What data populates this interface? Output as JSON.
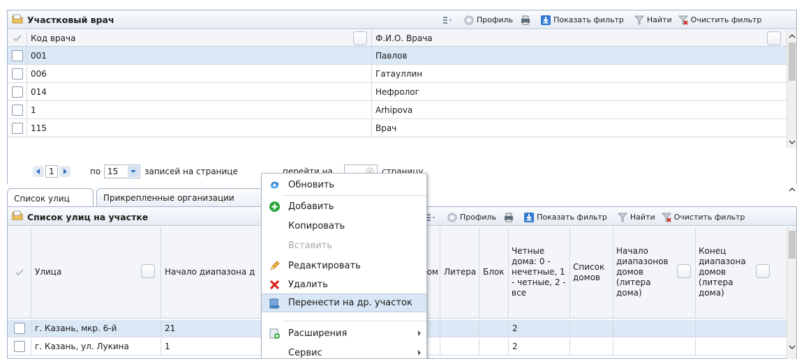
{
  "top_panel": {
    "title": "Участковый врач",
    "toolbar": {
      "profile": "Профиль",
      "show_filter": "Показать фильтр",
      "find": "Найти",
      "clear_filter": "Очистить фильтр"
    },
    "columns": [
      "Код врача",
      "Ф.И.О. Врача"
    ],
    "rows": [
      {
        "code": "001",
        "name": "Павлов",
        "selected": true
      },
      {
        "code": "006",
        "name": "Гатауллин",
        "selected": false
      },
      {
        "code": "014",
        "name": "Нефролог",
        "selected": false
      },
      {
        "code": "1",
        "name": "Arhipova",
        "selected": false
      },
      {
        "code": "115",
        "name": "Врач",
        "selected": false
      }
    ],
    "pager": {
      "current_page": "1",
      "per_page_prefix": "по",
      "per_page": "15",
      "per_page_suffix": "записей на странице",
      "goto_prefix": "перейти на",
      "goto_suffix": "страницу"
    }
  },
  "tabs": [
    {
      "label": "Список улиц",
      "active": true
    },
    {
      "label": "Прикрепленные организации",
      "active": false
    }
  ],
  "bottom_panel": {
    "title": "Список улиц на участке",
    "toolbar": {
      "profile": "Профиль",
      "show_filter": "Показать фильтр",
      "find": "Найти",
      "clear_filter": "Очистить фильтр"
    },
    "columns": {
      "street": "Улица",
      "range_start": "Начало диапазона д",
      "house_tail": "ом",
      "letter": "Литера",
      "block": "Блок",
      "even": "Четные дома: 0 - нечетные, 1 - четные, 2 - все",
      "houses_list": "Список домов",
      "ranges_start_letter": "Начало диапазонов домов (литера дома)",
      "range_end_letter": "Конец диапазона домов (литера дома)"
    },
    "rows": [
      {
        "street": "г. Казань, мкр. 6-й",
        "range_start": "21",
        "even": "2",
        "selected": true
      },
      {
        "street": "г. Казань, ул. Лукина",
        "range_start": "1",
        "even": "2",
        "selected": false
      }
    ]
  },
  "context_menu": {
    "items": [
      {
        "label": "Обновить",
        "icon": "refresh-icon",
        "enabled": true,
        "submenu": false
      },
      {
        "label": "Добавить",
        "icon": "add-icon",
        "enabled": true,
        "submenu": false
      },
      {
        "label": "Копировать",
        "icon": "",
        "enabled": true,
        "submenu": false
      },
      {
        "label": "Вставить",
        "icon": "",
        "enabled": false,
        "submenu": false
      },
      {
        "label": "Редактировать",
        "icon": "pencil-icon",
        "enabled": true,
        "submenu": false
      },
      {
        "label": "Удалить",
        "icon": "delete-icon",
        "enabled": true,
        "submenu": false
      },
      {
        "label": "Перенести на др. участок",
        "icon": "move-icon",
        "enabled": true,
        "submenu": false,
        "hover": true
      },
      {
        "label": "Расширения",
        "icon": "extensions-icon",
        "enabled": true,
        "submenu": true
      },
      {
        "label": "Сервис",
        "icon": "",
        "enabled": true,
        "submenu": true
      }
    ]
  },
  "colors": {
    "selected_row": "#dbe8f6",
    "border": "#9fb2c8",
    "menu_hover": "#d9e6f5"
  }
}
